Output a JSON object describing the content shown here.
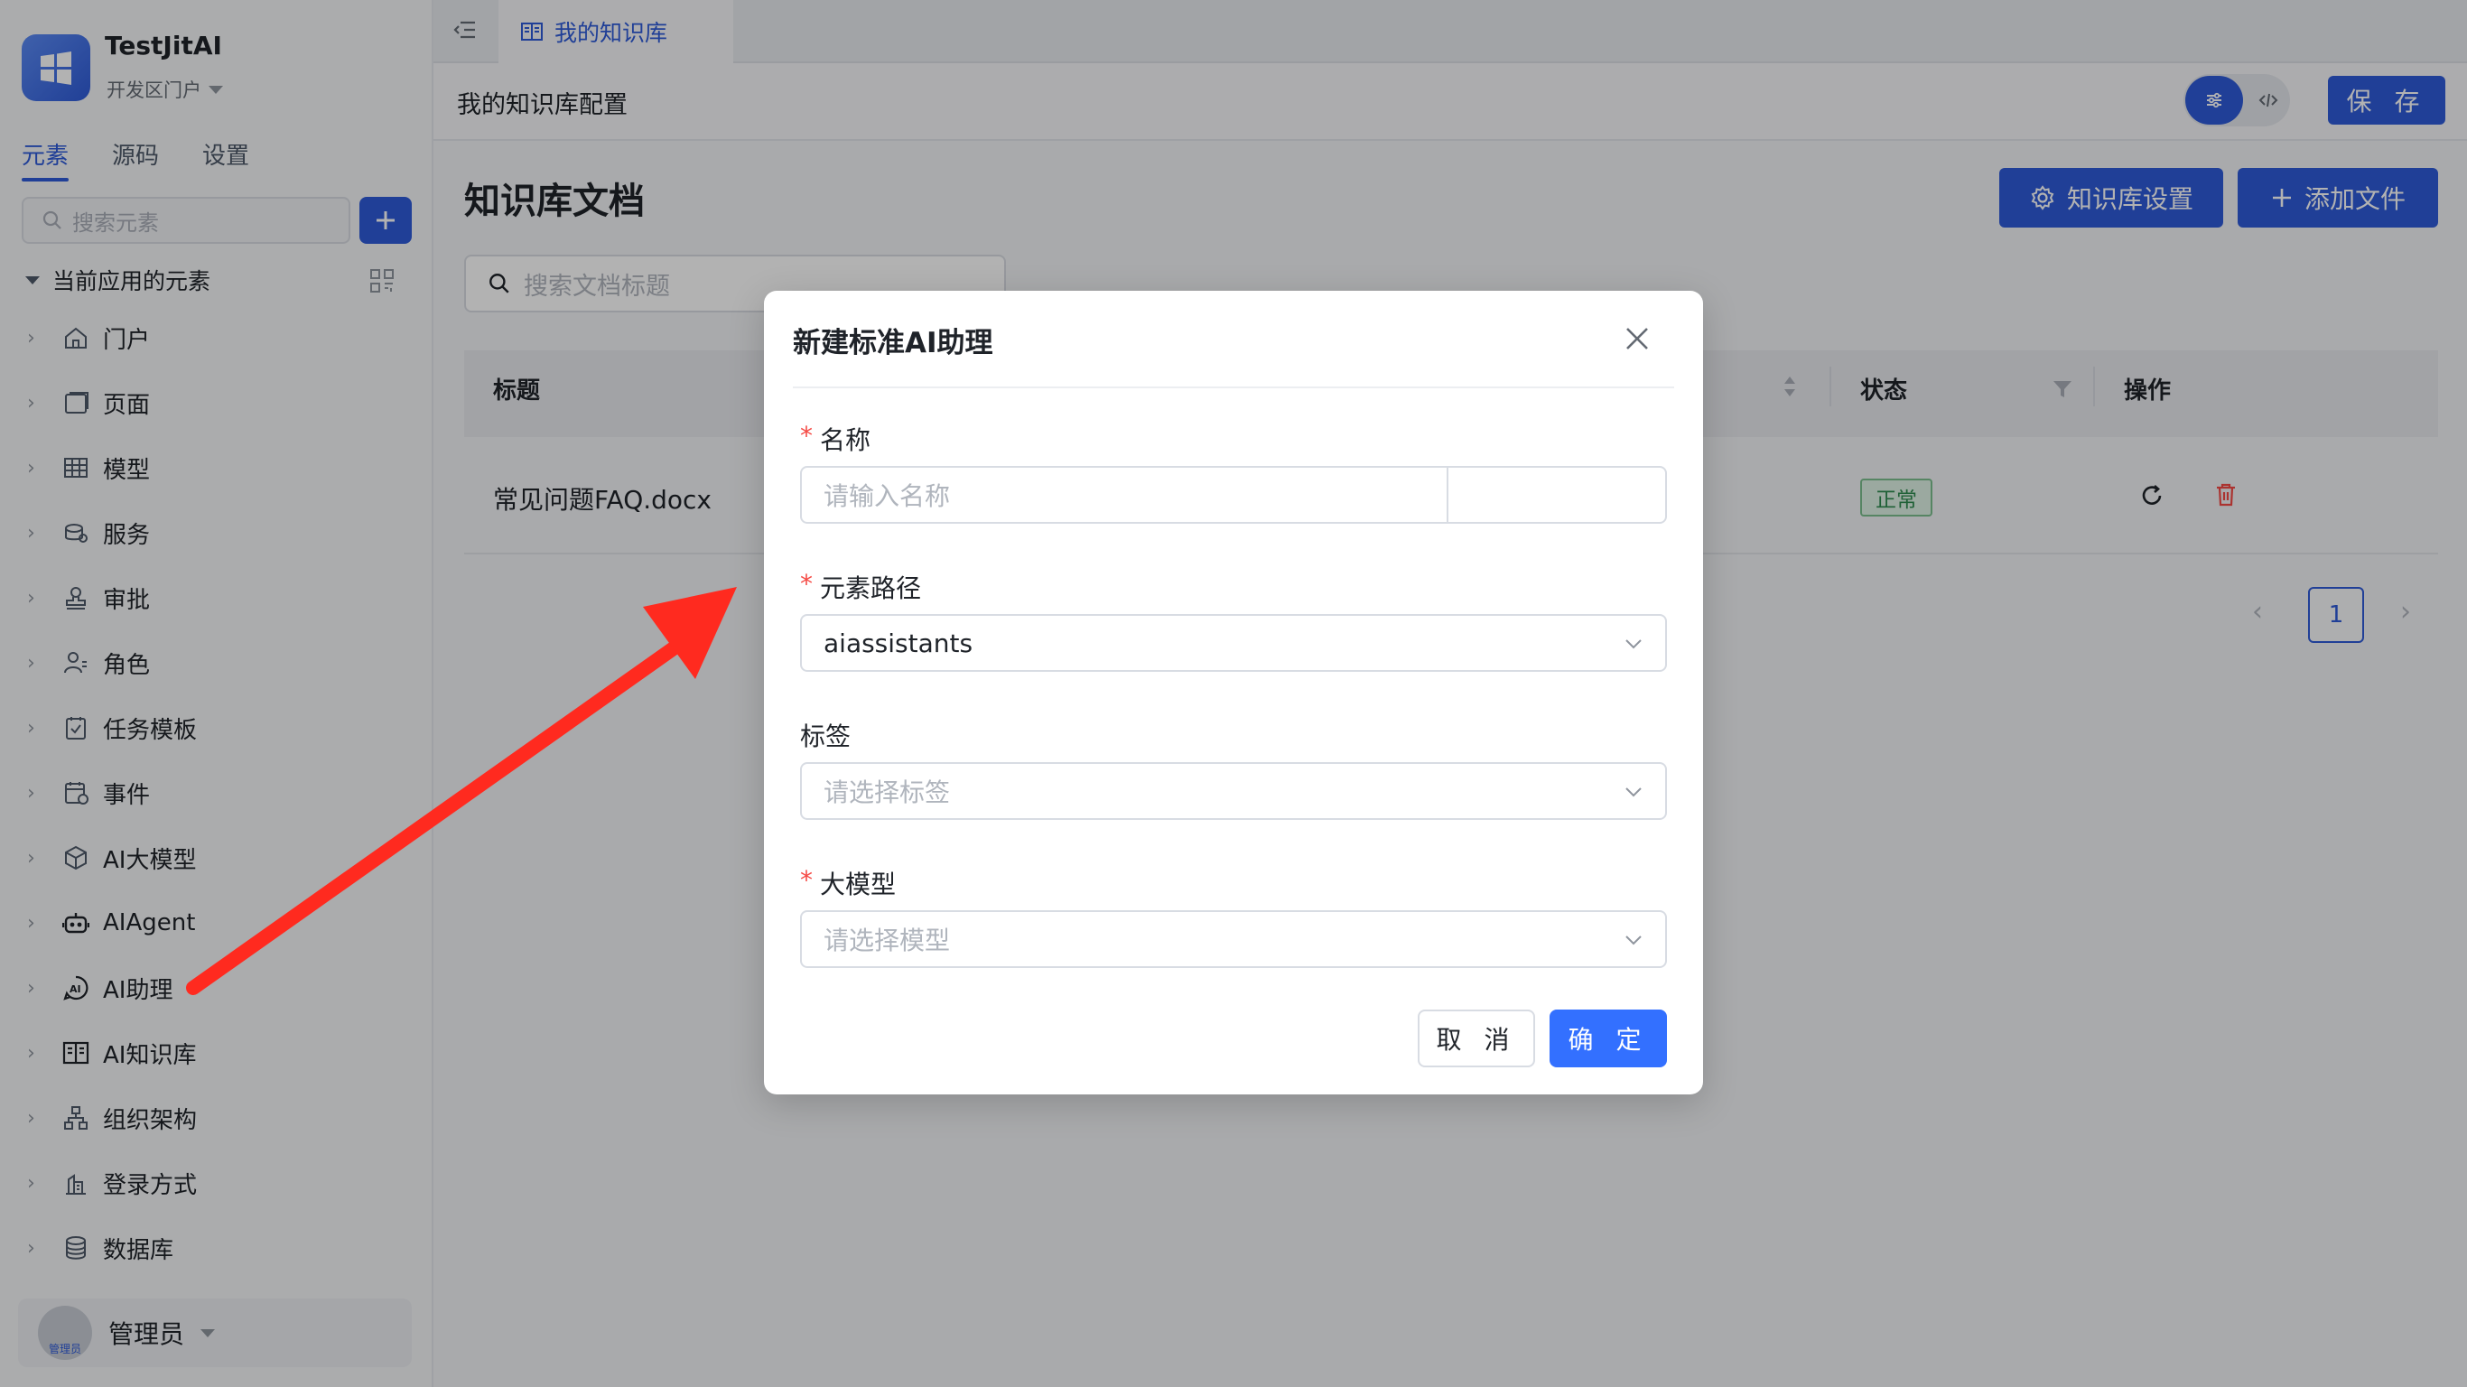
{
  "app": {
    "name": "TestJitAI",
    "portal": "开发区门户"
  },
  "sidebar": {
    "tabs": [
      {
        "label": "元素"
      },
      {
        "label": "源码"
      },
      {
        "label": "设置"
      }
    ],
    "search_placeholder": "搜索元素",
    "root_label": "当前应用的元素",
    "items": [
      {
        "label": "门户",
        "icon": "home-icon"
      },
      {
        "label": "页面",
        "icon": "page-icon"
      },
      {
        "label": "模型",
        "icon": "table-icon"
      },
      {
        "label": "服务",
        "icon": "service-icon"
      },
      {
        "label": "审批",
        "icon": "stamp-icon"
      },
      {
        "label": "角色",
        "icon": "role-icon"
      },
      {
        "label": "任务模板",
        "icon": "task-icon"
      },
      {
        "label": "事件",
        "icon": "event-icon"
      },
      {
        "label": "AI大模型",
        "icon": "cube-icon"
      },
      {
        "label": "AIAgent",
        "icon": "robot-icon"
      },
      {
        "label": "AI助理",
        "icon": "ai-assistant-icon"
      },
      {
        "label": "AI知识库",
        "icon": "book-icon"
      },
      {
        "label": "组织架构",
        "icon": "org-icon"
      },
      {
        "label": "登录方式",
        "icon": "login-icon"
      },
      {
        "label": "数据库",
        "icon": "database-icon"
      }
    ],
    "user": {
      "name": "管理员",
      "avatar_text": "管理员"
    }
  },
  "tabbar": {
    "active_tab": "我的知识库"
  },
  "toolbar": {
    "title": "我的知识库配置",
    "save_label": "保 存"
  },
  "main": {
    "page_title": "知识库文档",
    "kb_settings_label": "知识库设置",
    "add_file_label": "添加文件",
    "search_placeholder": "搜索文档标题",
    "table": {
      "columns": [
        "标题",
        "状态",
        "操作"
      ],
      "rows": [
        {
          "title": "常见问题FAQ.docx",
          "status": "正常"
        }
      ]
    },
    "pagination": {
      "current_page": "1"
    }
  },
  "modal": {
    "title": "新建标准AI助理",
    "name_label": "名称",
    "name_placeholder": "请输入名称",
    "path_label": "元素路径",
    "path_value": "aiassistants",
    "tags_label": "标签",
    "tags_placeholder": "请选择标签",
    "model_label": "大模型",
    "model_placeholder": "请选择模型",
    "required_mark": "*",
    "cancel_label": "取 消",
    "ok_label": "确 定"
  },
  "colors": {
    "accent": "#2f5bd8",
    "primary_button": "#3370ff",
    "annotation_arrow": "#ff2a1f",
    "status_ok": "#2e8b4f"
  }
}
